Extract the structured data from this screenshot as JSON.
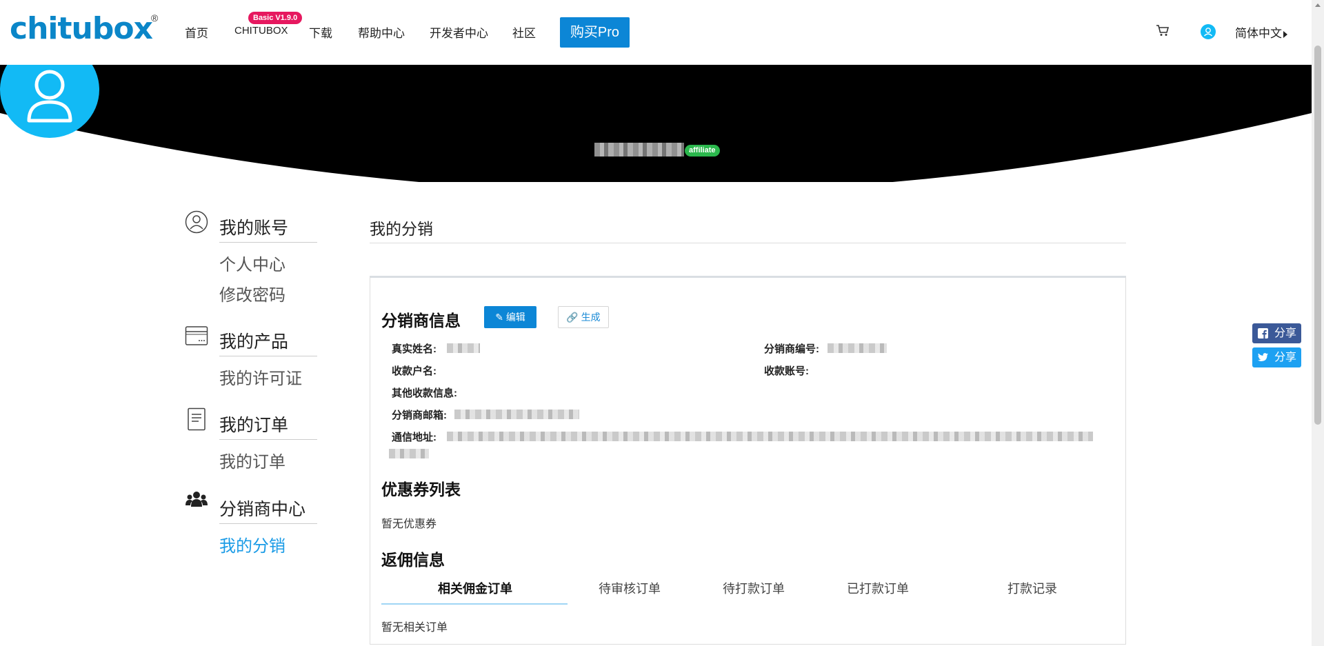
{
  "header": {
    "logo_text_a": "chitu",
    "logo_text_b": "box",
    "logo_reg": "®",
    "nav": [
      "首页",
      "CHITUBOX",
      "下载",
      "帮助中心",
      "开发者中心",
      "社区"
    ],
    "version_badge": "Basic V1.9.0",
    "buy_pro": "购买Pro",
    "language": "简体中文"
  },
  "profile": {
    "affiliate_badge": "affiliate"
  },
  "sidebar": {
    "groups": [
      {
        "title": "我的账号",
        "icon": "user-circle-icon",
        "links": [
          "个人中心",
          "修改密码"
        ]
      },
      {
        "title": "我的产品",
        "icon": "product-card-icon",
        "links": [
          "我的许可证"
        ]
      },
      {
        "title": "我的订单",
        "icon": "document-icon",
        "links": [
          "我的订单"
        ]
      },
      {
        "title": "分销商中心",
        "icon": "users-group-icon",
        "links": [
          "我的分销"
        ]
      }
    ],
    "active_link": "我的分销"
  },
  "main": {
    "title": "我的分销",
    "distributor": {
      "section_title": "分销商信息",
      "edit_button": "编辑",
      "generate_button": "生成",
      "labels": {
        "real_name": "真实姓名:",
        "distributor_no": "分销商编号:",
        "account_name": "收款户名:",
        "account_no": "收款账号:",
        "other_info": "其他收款信息:",
        "email": "分销商邮箱:",
        "address": "通信地址:"
      }
    },
    "coupons": {
      "section_title": "优惠券列表",
      "empty": "暂无优惠券"
    },
    "rebate": {
      "section_title": "返佣信息",
      "tabs": [
        "相关佣金订单",
        "待审核订单",
        "待打款订单",
        "已打款订单",
        "打款记录"
      ],
      "active_tab": 0,
      "empty": "暂无相关订单"
    }
  },
  "share": {
    "facebook": "分享",
    "twitter": "分享"
  },
  "colors": {
    "brand_blue": "#0c86d6",
    "avatar_blue": "#12baf5",
    "active_link": "#1a9be6",
    "badge_red": "#e6185f",
    "badge_green": "#2bb84d"
  }
}
